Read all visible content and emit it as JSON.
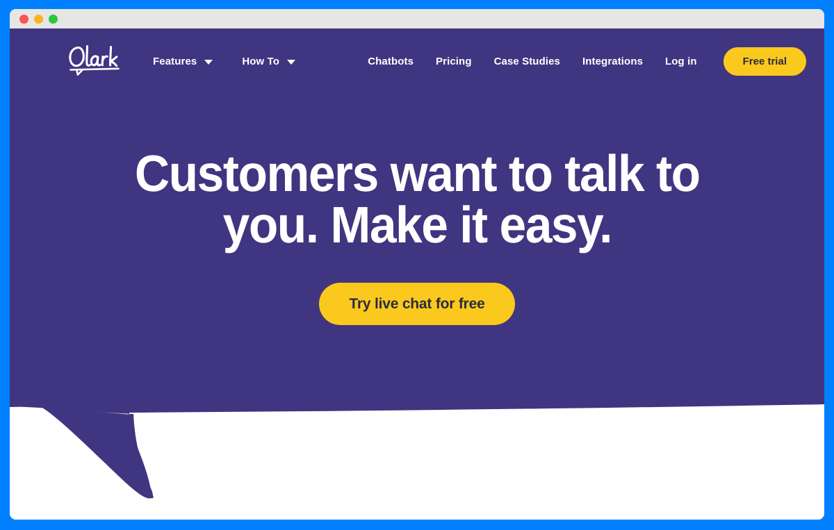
{
  "window": {
    "traffic_lights": [
      {
        "name": "close",
        "color": "#f9564f"
      },
      {
        "name": "minimize",
        "color": "#f9b41e"
      },
      {
        "name": "maximize",
        "color": "#2dc63c"
      }
    ]
  },
  "theme": {
    "frame_blue": "#0080ff",
    "brand_purple": "#403580",
    "accent_yellow": "#fbc91e",
    "titlebar_gray": "#e6e6e6",
    "text_white": "#ffffff",
    "button_text_dark": "#2b2b3c"
  },
  "navbar": {
    "logo_text": "Olark",
    "logo_icon": "olark-script-wordmark-with-chat-bubble-underline",
    "left_items": [
      {
        "label": "Features",
        "has_dropdown": true,
        "icon": "chevron-down-icon"
      },
      {
        "label": "How To",
        "has_dropdown": true,
        "icon": "chevron-down-icon"
      }
    ],
    "right_items": [
      {
        "label": "Chatbots",
        "has_dropdown": false
      },
      {
        "label": "Pricing",
        "has_dropdown": false
      },
      {
        "label": "Case Studies",
        "has_dropdown": false
      },
      {
        "label": "Integrations",
        "has_dropdown": false
      },
      {
        "label": "Log in",
        "has_dropdown": false
      }
    ],
    "cta_label": "Free trial"
  },
  "hero": {
    "headline_line_1": "Customers want to talk to",
    "headline_line_2": "you. Make it easy.",
    "cta_label": "Try live chat for free"
  }
}
